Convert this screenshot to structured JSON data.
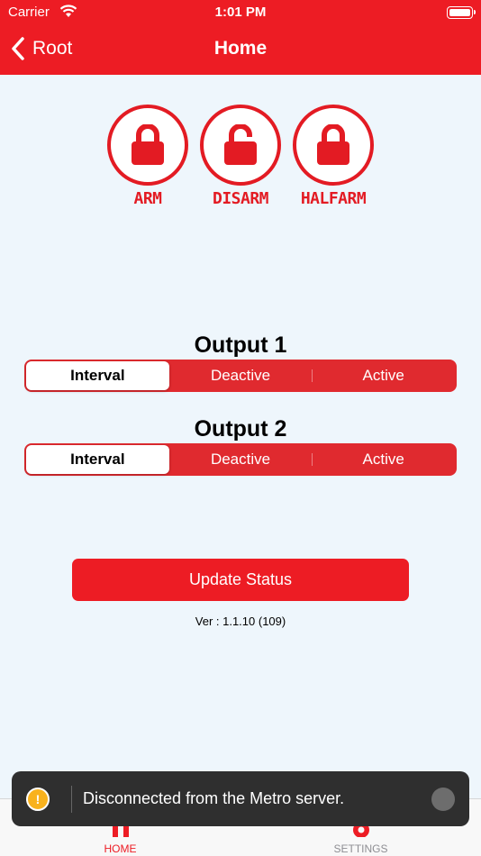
{
  "status_bar": {
    "carrier": "Carrier",
    "time": "1:01 PM"
  },
  "nav": {
    "back_label": "Root",
    "title": "Home"
  },
  "modes": [
    {
      "label": "ARM",
      "icon": "lock-closed-icon"
    },
    {
      "label": "DISARM",
      "icon": "lock-open-icon"
    },
    {
      "label": "HALFARM",
      "icon": "lock-closed-icon"
    }
  ],
  "outputs": [
    {
      "title": "Output 1",
      "options": [
        "Interval",
        "Deactive",
        "Active"
      ],
      "selected": "Interval"
    },
    {
      "title": "Output 2",
      "options": [
        "Interval",
        "Deactive",
        "Active"
      ],
      "selected": "Interval"
    }
  ],
  "update_button": "Update Status",
  "version": "Ver : 1.1.10 (109)",
  "tabbar": {
    "home_label": "HOME",
    "settings_label": "SETTINGS"
  },
  "toast": {
    "icon": "warning-icon",
    "message": "Disconnected from the Metro server."
  },
  "colors": {
    "accent": "#ed1c24",
    "background": "#eef6fc",
    "toast_background": "#2f2f2f",
    "warning": "#f9b21d"
  }
}
